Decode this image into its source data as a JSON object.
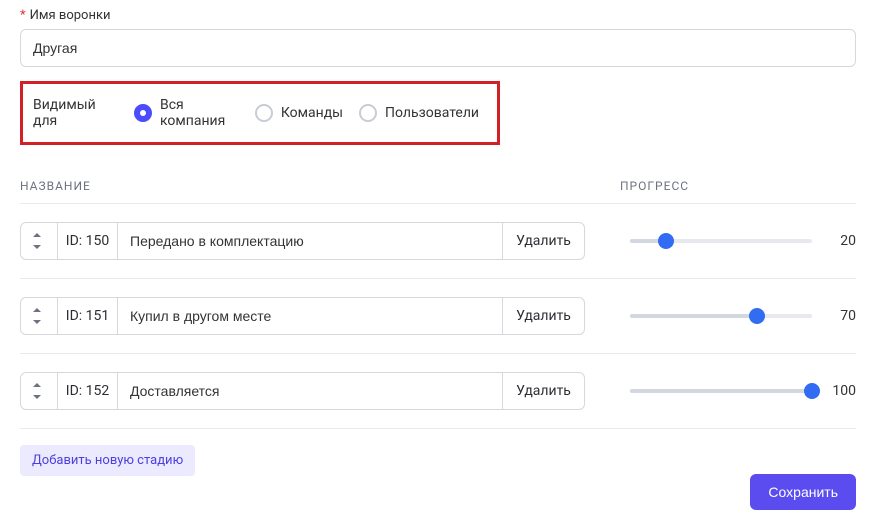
{
  "field_label": "Имя воронки",
  "field_value": "Другая",
  "visibility": {
    "label": "Видимый для",
    "options": [
      "Вся компания",
      "Команды",
      "Пользователи"
    ],
    "selected": 0
  },
  "columns": {
    "name": "НАЗВАНИЕ",
    "progress": "ПРОГРЕСС"
  },
  "delete_label": "Удалить",
  "stages": [
    {
      "id_label": "ID: 150",
      "name": "Передано в комплектацию",
      "progress": 20
    },
    {
      "id_label": "ID: 151",
      "name": "Купил в другом месте",
      "progress": 70
    },
    {
      "id_label": "ID: 152",
      "name": "Доставляется",
      "progress": 100
    }
  ],
  "add_stage_label": "Добавить новую стадию",
  "save_label": "Сохранить"
}
